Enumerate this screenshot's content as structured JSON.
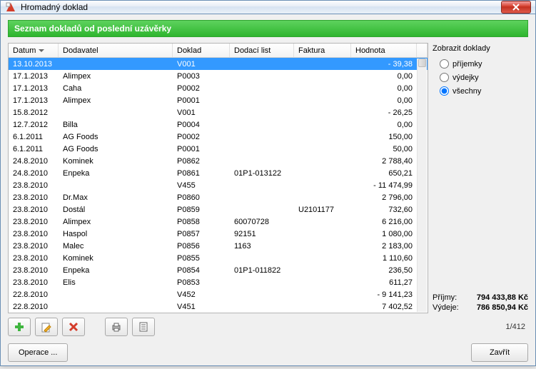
{
  "window": {
    "title": "Hromadný doklad",
    "close_tooltip": "Zavřít"
  },
  "banner": "Seznam dokladů od poslední uzávěrky",
  "columns": {
    "datum": "Datum",
    "dodavatel": "Dodavatel",
    "doklad": "Doklad",
    "dodaci": "Dodací list",
    "faktura": "Faktura",
    "hodnota": "Hodnota"
  },
  "rows": [
    {
      "datum": "13.10.2013",
      "dodavatel": "",
      "doklad": "V001",
      "dodaci": "",
      "faktura": "",
      "hodnota": "- 39,38",
      "selected": true
    },
    {
      "datum": "17.1.2013",
      "dodavatel": "Alimpex",
      "doklad": "P0003",
      "dodaci": "",
      "faktura": "",
      "hodnota": "0,00"
    },
    {
      "datum": "17.1.2013",
      "dodavatel": "Caha",
      "doklad": "P0002",
      "dodaci": "",
      "faktura": "",
      "hodnota": "0,00"
    },
    {
      "datum": "17.1.2013",
      "dodavatel": "Alimpex",
      "doklad": "P0001",
      "dodaci": "",
      "faktura": "",
      "hodnota": "0,00"
    },
    {
      "datum": "15.8.2012",
      "dodavatel": "",
      "doklad": "V001",
      "dodaci": "",
      "faktura": "",
      "hodnota": "- 26,25"
    },
    {
      "datum": "12.7.2012",
      "dodavatel": "Billa",
      "doklad": "P0004",
      "dodaci": "",
      "faktura": "",
      "hodnota": "0,00"
    },
    {
      "datum": "6.1.2011",
      "dodavatel": "AG Foods",
      "doklad": "P0002",
      "dodaci": "",
      "faktura": "",
      "hodnota": "150,00"
    },
    {
      "datum": "6.1.2011",
      "dodavatel": "AG Foods",
      "doklad": "P0001",
      "dodaci": "",
      "faktura": "",
      "hodnota": "50,00"
    },
    {
      "datum": "24.8.2010",
      "dodavatel": "Kominek",
      "doklad": "P0862",
      "dodaci": "",
      "faktura": "",
      "hodnota": "2 788,40"
    },
    {
      "datum": "24.8.2010",
      "dodavatel": "Enpeka",
      "doklad": "P0861",
      "dodaci": "01P1-013122",
      "faktura": "",
      "hodnota": "650,21"
    },
    {
      "datum": "23.8.2010",
      "dodavatel": "",
      "doklad": "V455",
      "dodaci": "",
      "faktura": "",
      "hodnota": "- 11 474,99"
    },
    {
      "datum": "23.8.2010",
      "dodavatel": "Dr.Max",
      "doklad": "P0860",
      "dodaci": "",
      "faktura": "",
      "hodnota": "2 796,00"
    },
    {
      "datum": "23.8.2010",
      "dodavatel": "Dostál",
      "doklad": "P0859",
      "dodaci": "",
      "faktura": "U2101177",
      "hodnota": "732,60"
    },
    {
      "datum": "23.8.2010",
      "dodavatel": "Alimpex",
      "doklad": "P0858",
      "dodaci": "60070728",
      "faktura": "",
      "hodnota": "6 216,00"
    },
    {
      "datum": "23.8.2010",
      "dodavatel": "Haspol",
      "doklad": "P0857",
      "dodaci": "92151",
      "faktura": "",
      "hodnota": "1 080,00"
    },
    {
      "datum": "23.8.2010",
      "dodavatel": "Malec",
      "doklad": "P0856",
      "dodaci": "1163",
      "faktura": "",
      "hodnota": "2 183,00"
    },
    {
      "datum": "23.8.2010",
      "dodavatel": "Kominek",
      "doklad": "P0855",
      "dodaci": "",
      "faktura": "",
      "hodnota": "1 110,60"
    },
    {
      "datum": "23.8.2010",
      "dodavatel": "Enpeka",
      "doklad": "P0854",
      "dodaci": "01P1-011822",
      "faktura": "",
      "hodnota": "236,50"
    },
    {
      "datum": "23.8.2010",
      "dodavatel": "Elis",
      "doklad": "P0853",
      "dodaci": "",
      "faktura": "",
      "hodnota": "611,27"
    },
    {
      "datum": "22.8.2010",
      "dodavatel": "",
      "doklad": "V452",
      "dodaci": "",
      "faktura": "",
      "hodnota": "- 9 141,23"
    },
    {
      "datum": "22.8.2010",
      "dodavatel": "",
      "doklad": "V451",
      "dodaci": "",
      "faktura": "",
      "hodnota": "7 402,52"
    }
  ],
  "filter": {
    "title": "Zobrazit doklady",
    "prijemky": "příjemky",
    "vydejky": "výdejky",
    "vsechny": "všechny",
    "selected": "vsechny"
  },
  "totals": {
    "prijmy_label": "Příjmy:",
    "prijmy_value": "794 433,88 Kč",
    "vydeje_label": "Výdeje:",
    "vydeje_value": "786 850,94 Kč"
  },
  "pager": "1/412",
  "buttons": {
    "operace": "Operace ...",
    "zavrit": "Zavřít"
  },
  "icons": {
    "add": "add-icon",
    "edit": "edit-icon",
    "delete": "delete-icon",
    "print": "print-icon",
    "list": "list-icon"
  }
}
